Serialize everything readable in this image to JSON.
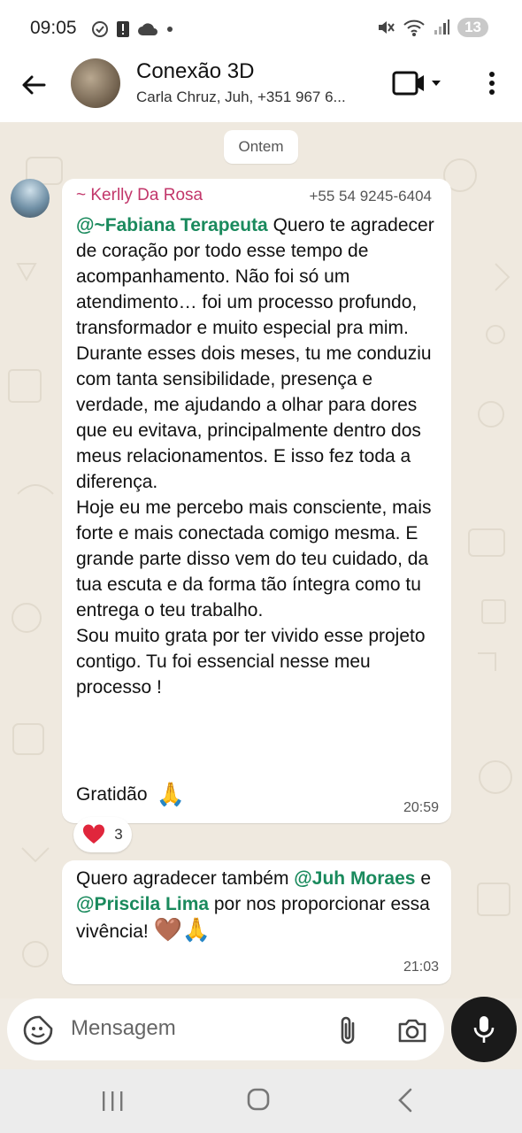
{
  "status_bar": {
    "time": "09:05",
    "battery_badge": "13"
  },
  "header": {
    "group_name": "Conexão 3D",
    "members": "Carla Chruz, Juh, +351 967 6..."
  },
  "chat": {
    "date_chip": "Ontem",
    "message1": {
      "sender": "~ Kerlly Da Rosa",
      "sender_phone": "+55 54 9245-6404",
      "mention": "@~Fabiana Terapeuta",
      "text_after_mention": " Quero te agradecer de coração por todo esse tempo de acompanhamento. Não foi só um atendimento… foi um processo profundo, transformador e muito especial pra mim.",
      "paragraph2": "Durante esses dois meses, tu me conduziu com tanta sensibilidade, presença e verdade, me ajudando a olhar para dores que eu evitava, principalmente dentro dos meus relacionamentos. E isso fez toda a diferença.",
      "paragraph3": "Hoje eu me percebo mais consciente, mais forte e mais conectada comigo mesma. E grande parte disso vem do teu cuidado, da tua escuta e da forma tão íntegra como tu entrega o teu trabalho.",
      "paragraph4": "Sou muito grata por ter vivido esse projeto contigo. Tu foi essencial nesse meu processo !",
      "closing": "Gratidão",
      "closing_emoji": "🙏",
      "time": "20:59",
      "reaction_emoji": "❤️",
      "reaction_count": "3"
    },
    "message2": {
      "text_before": "Quero agradecer também ",
      "mention1": "@Juh Moraes",
      "text_mid": " e ",
      "mention2": "@Priscila Lima",
      "text_after": " por nos proporcionar essa vivência!",
      "emojis": "🤎🙏",
      "time": "21:03"
    }
  },
  "input": {
    "placeholder": "Mensagem"
  },
  "icons": {
    "back": "arrow-left-icon",
    "video": "video-camera-icon",
    "dropdown": "caret-down-icon",
    "more": "more-vertical-icon",
    "emoji": "emoji-sticker-icon",
    "attach": "paperclip-icon",
    "camera": "camera-icon",
    "mic": "microphone-icon"
  },
  "colors": {
    "sender_name": "#c2366a",
    "mention": "#1a8a5d",
    "chat_background": "#efe9df",
    "mic_button": "#1a1a1a"
  }
}
